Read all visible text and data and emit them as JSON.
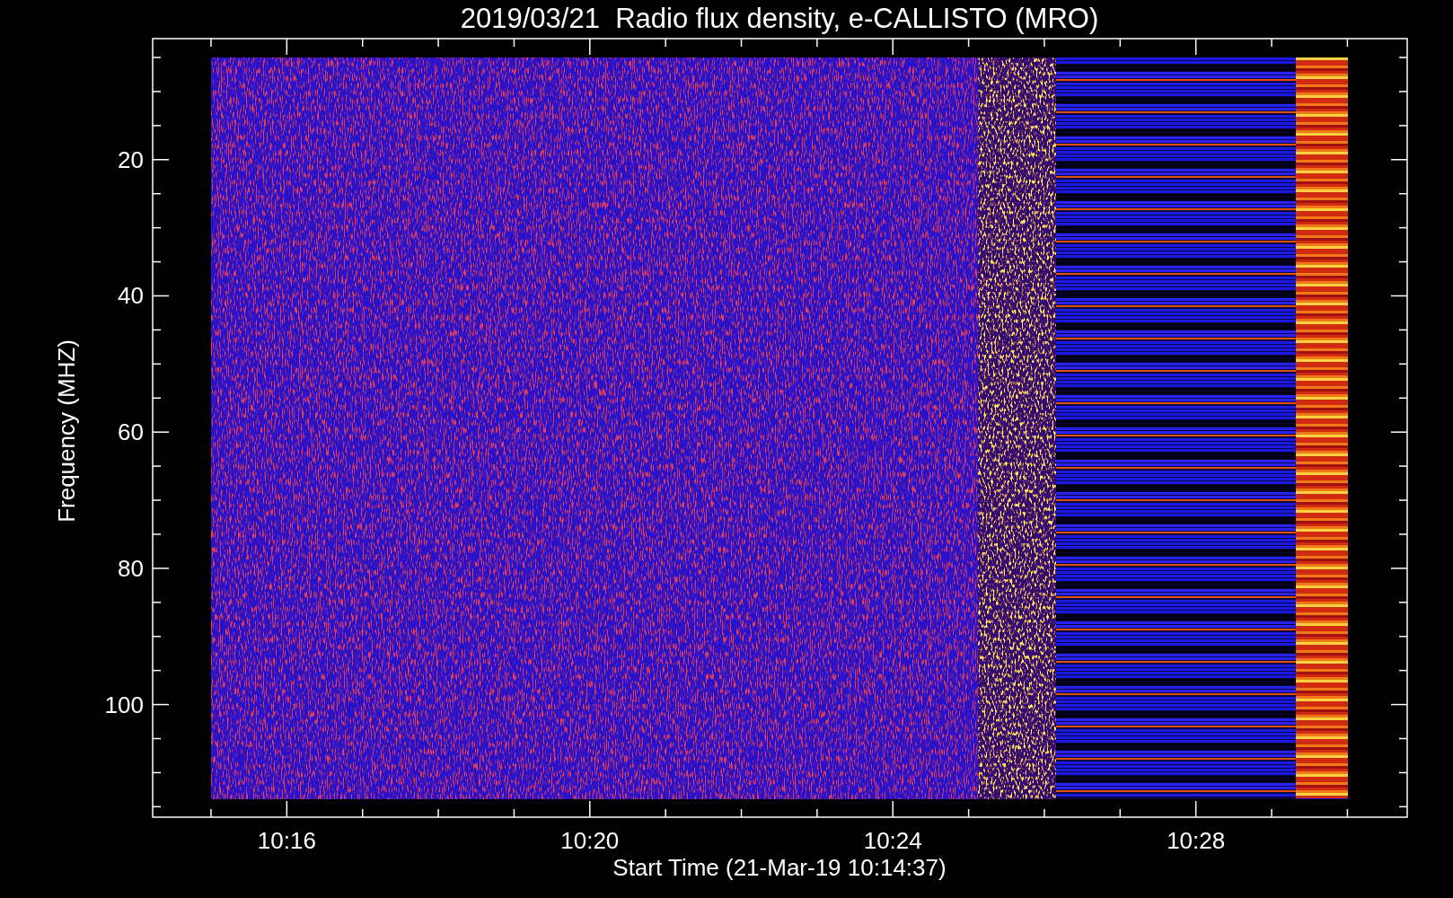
{
  "title": "2019/03/21  Radio flux density, e-CALLISTO (MRO)",
  "y_axis": {
    "label": "Frequency (MHZ)",
    "tick_labels": [
      "20",
      "40",
      "60",
      "80",
      "100"
    ]
  },
  "x_axis": {
    "label": "Start Time (21-Mar-19 10:14:37)",
    "tick_labels": [
      "10:16",
      "10:20",
      "10:24",
      "10:28"
    ]
  }
}
